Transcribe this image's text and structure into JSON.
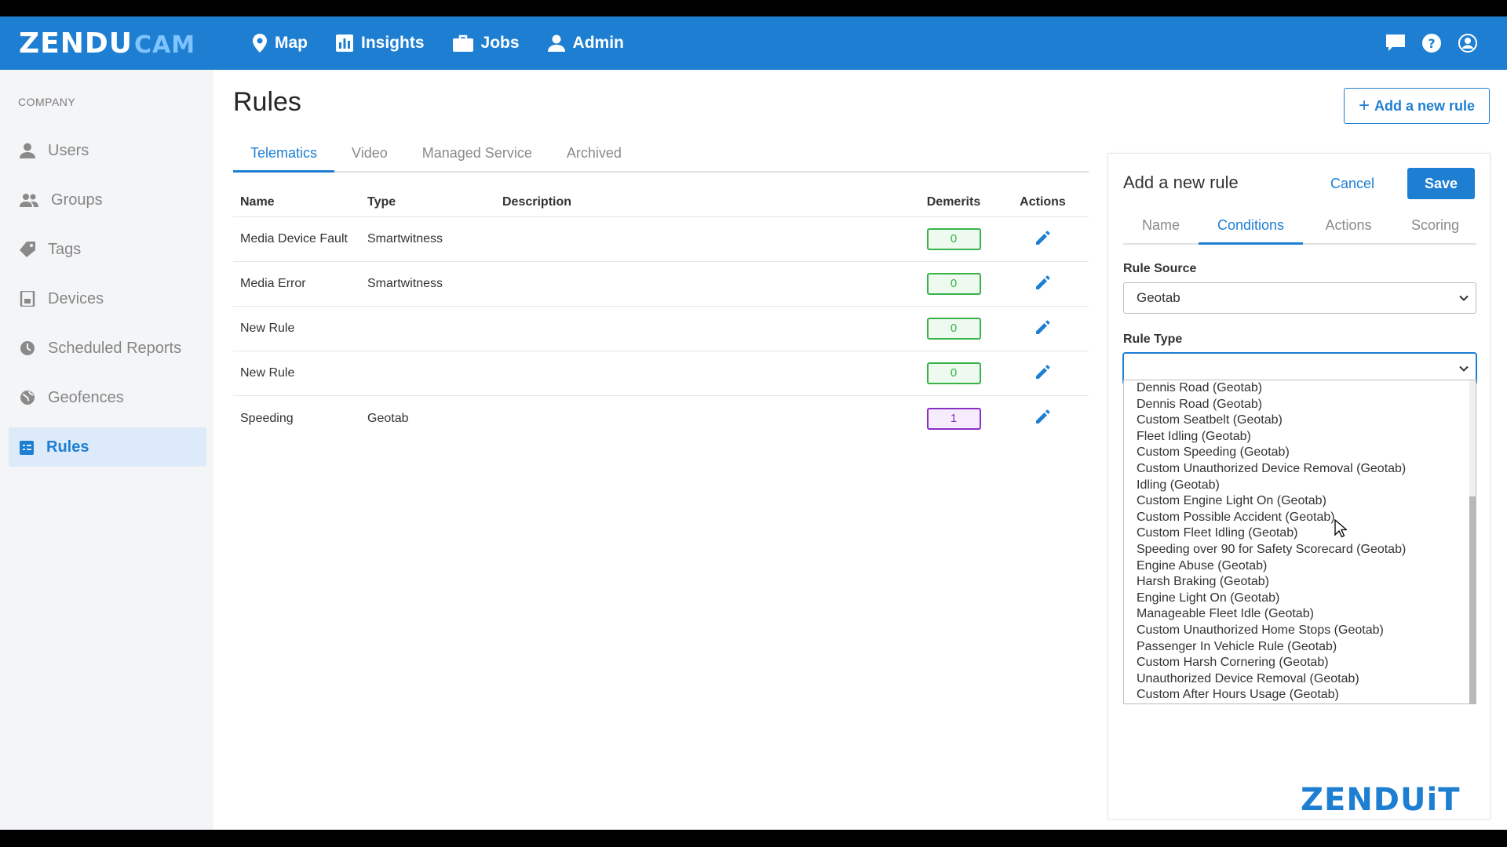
{
  "app": {
    "logo_primary": "ZENDU",
    "logo_secondary": "CAM",
    "brand_color": "#1e7fd2",
    "footer_logo": "ZENDUiT"
  },
  "nav": {
    "items": [
      {
        "label": "Map",
        "icon": "map-pin-icon"
      },
      {
        "label": "Insights",
        "icon": "bar-chart-icon"
      },
      {
        "label": "Jobs",
        "icon": "briefcase-icon"
      },
      {
        "label": "Admin",
        "icon": "user-icon"
      }
    ],
    "right_icons": [
      "chat-icon",
      "help-icon",
      "account-icon"
    ]
  },
  "sidebar": {
    "section": "COMPANY",
    "items": [
      {
        "label": "Users",
        "icon": "user-icon"
      },
      {
        "label": "Groups",
        "icon": "group-icon"
      },
      {
        "label": "Tags",
        "icon": "tag-icon"
      },
      {
        "label": "Devices",
        "icon": "device-icon"
      },
      {
        "label": "Scheduled Reports",
        "icon": "report-icon"
      },
      {
        "label": "Geofences",
        "icon": "globe-icon"
      },
      {
        "label": "Rules",
        "icon": "rules-icon",
        "active": true
      }
    ]
  },
  "page": {
    "title": "Rules",
    "add_button": "Add a new rule",
    "tabs": [
      "Telematics",
      "Video",
      "Managed Service",
      "Archived"
    ],
    "active_tab": "Telematics"
  },
  "table": {
    "columns": [
      "Name",
      "Type",
      "Description",
      "Demerits",
      "Actions"
    ],
    "rows": [
      {
        "name": "Media Device Fault",
        "type": "Smartwitness",
        "description": "",
        "demerits": "0"
      },
      {
        "name": "Media Error",
        "type": "Smartwitness",
        "description": "",
        "demerits": "0"
      },
      {
        "name": "New Rule",
        "type": "",
        "description": "",
        "demerits": "0"
      },
      {
        "name": "New Rule",
        "type": "",
        "description": "",
        "demerits": "0"
      },
      {
        "name": "Speeding",
        "type": "Geotab",
        "description": "",
        "demerits": "1"
      }
    ]
  },
  "panel": {
    "title": "Add a new rule",
    "cancel": "Cancel",
    "save": "Save",
    "tabs": [
      "Name",
      "Conditions",
      "Actions",
      "Scoring"
    ],
    "active_tab": "Conditions",
    "rule_source_label": "Rule Source",
    "rule_source_value": "Geotab",
    "rule_type_label": "Rule Type",
    "rule_type_value": "",
    "rule_type_options": [
      "Dennis Road (Geotab)",
      "Dennis Road (Geotab)",
      "Custom Seatbelt (Geotab)",
      "Fleet Idling (Geotab)",
      "Custom Speeding (Geotab)",
      "Custom Unauthorized Device Removal (Geotab)",
      "Idling (Geotab)",
      "Custom Engine Light On (Geotab)",
      "Custom Possible Accident (Geotab)",
      "Custom Fleet Idling (Geotab)",
      "Speeding over 90 for Safety Scorecard (Geotab)",
      "Engine Abuse (Geotab)",
      "Harsh Braking (Geotab)",
      "Engine Light On (Geotab)",
      "Manageable Fleet Idle (Geotab)",
      "Custom Unauthorized Home Stops (Geotab)",
      "Passenger In Vehicle Rule (Geotab)",
      "Custom Harsh Cornering (Geotab)",
      "Unauthorized Device Removal (Geotab)",
      "Custom After Hours Usage (Geotab)"
    ]
  }
}
